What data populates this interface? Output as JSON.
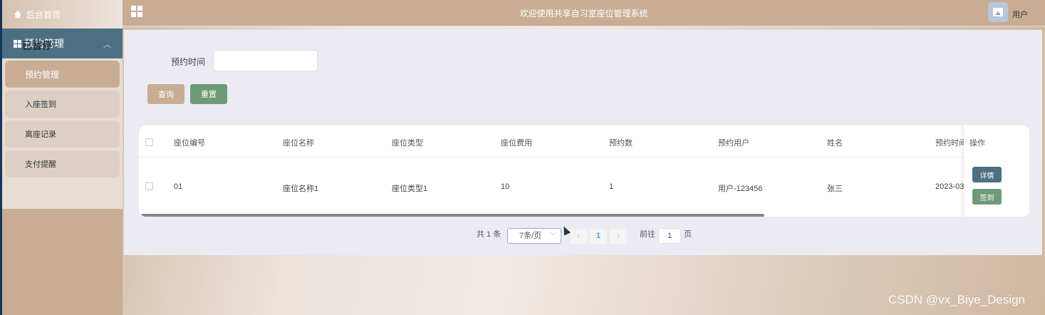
{
  "sidebar": {
    "home_label": "后台首页",
    "group_label": "预约管理",
    "overlay_label": "已暂停",
    "items": [
      {
        "label": "预约管理"
      },
      {
        "label": "入座签到"
      },
      {
        "label": "离座记录"
      },
      {
        "label": "支付提醒"
      }
    ]
  },
  "header": {
    "title": "欢迎使用共享自习室座位管理系统",
    "user_label": "用户"
  },
  "search": {
    "label": "预约时间",
    "value": "",
    "query_button": "查询",
    "reset_button": "重置"
  },
  "table": {
    "columns": [
      "座位编号",
      "座位名称",
      "座位类型",
      "座位费用",
      "预约数",
      "预约用户",
      "姓名",
      "预约时间"
    ],
    "operation_header": "操作",
    "rows": [
      {
        "cells": [
          "01",
          "座位名称1",
          "座位类型1",
          "10",
          "1",
          "用户-123456",
          "张三",
          "2023-03"
        ],
        "detail_button": "详情",
        "checkin_button": "签到"
      }
    ]
  },
  "pagination": {
    "total": "共 1 条",
    "page_size": "7条/页",
    "prev": "‹",
    "current_page": "1",
    "next": "›",
    "goto_label": "前往",
    "goto_value": "1",
    "page_suffix": "页"
  },
  "watermark": "CSDN @vx_Biye_Design",
  "colors": {
    "accent": "#c8ad94",
    "group_header": "#4d6f82",
    "reset_button": "#6f9a76",
    "detail_button": "#4d6f82",
    "checkin_button": "#6f9a76"
  }
}
